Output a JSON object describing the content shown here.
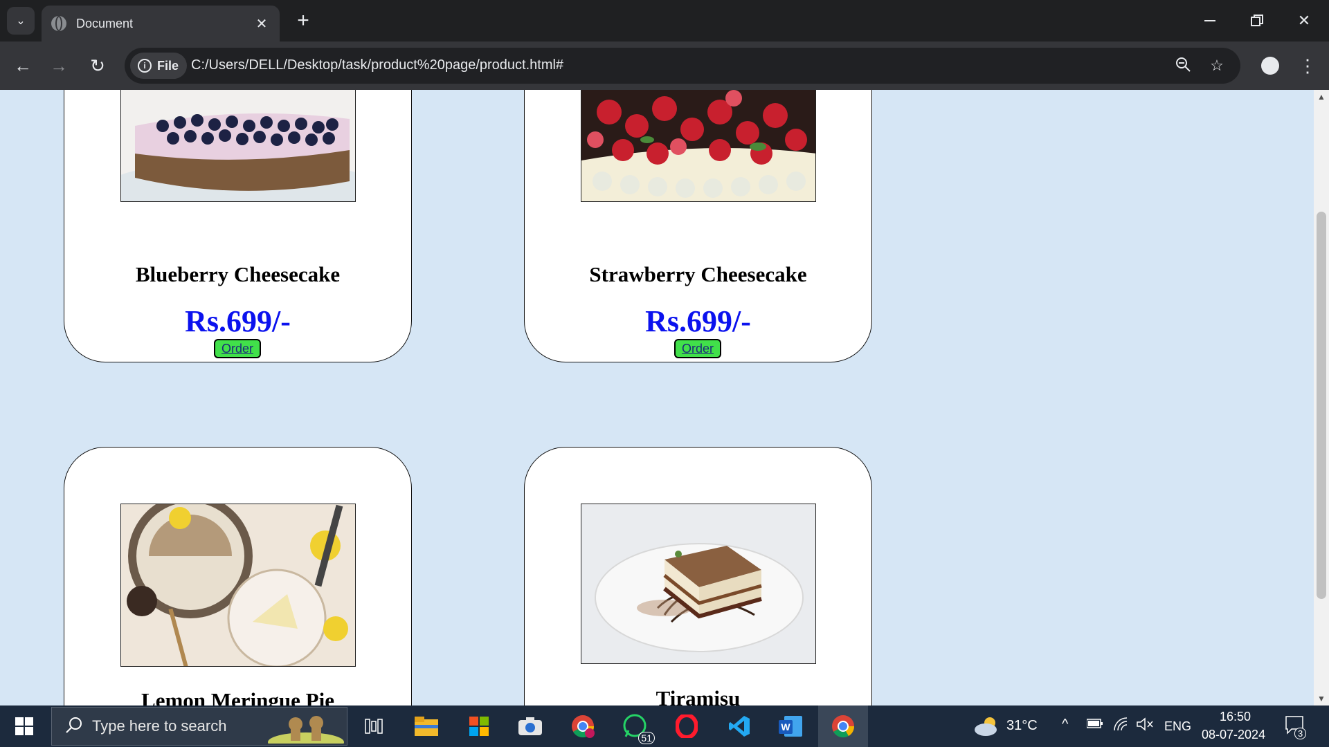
{
  "browser": {
    "tab_title": "Document",
    "file_chip": "File",
    "url": "C:/Users/DELL/Desktop/task/product%20page/product.html#"
  },
  "products": [
    {
      "name": "Blueberry Cheesecake",
      "price": "Rs.699/-",
      "order_label": "Order"
    },
    {
      "name": "Strawberry Cheesecake",
      "price": "Rs.699/-",
      "order_label": "Order"
    },
    {
      "name": "Lemon Meringue Pie"
    },
    {
      "name": "Tiramisu"
    }
  ],
  "taskbar": {
    "search_placeholder": "Type here to search",
    "weather": "31°C",
    "language": "ENG",
    "time": "16:50",
    "date": "08-07-2024",
    "whatsapp_badge": "51",
    "notification_count": "3"
  },
  "colors": {
    "page_background": "#d6e6f5",
    "price": "#0b12ee",
    "order_button": "#41e04a"
  },
  "icons": [
    "tab-list-icon",
    "globe-icon",
    "close-icon",
    "new-tab-icon",
    "minimize-icon",
    "restore-icon",
    "window-close-icon",
    "back-icon",
    "forward-icon",
    "reload-icon",
    "info-icon",
    "zoom-icon",
    "star-icon",
    "profile-icon",
    "menu-icon",
    "windows-start-icon",
    "search-icon",
    "task-view-icon",
    "file-explorer-icon",
    "store-icon",
    "camera-icon",
    "chrome-icon",
    "whatsapp-icon",
    "opera-icon",
    "vscode-icon",
    "word-icon",
    "weather-icon",
    "chevron-up-icon",
    "battery-icon",
    "wifi-icon",
    "mute-icon",
    "notification-icon"
  ]
}
